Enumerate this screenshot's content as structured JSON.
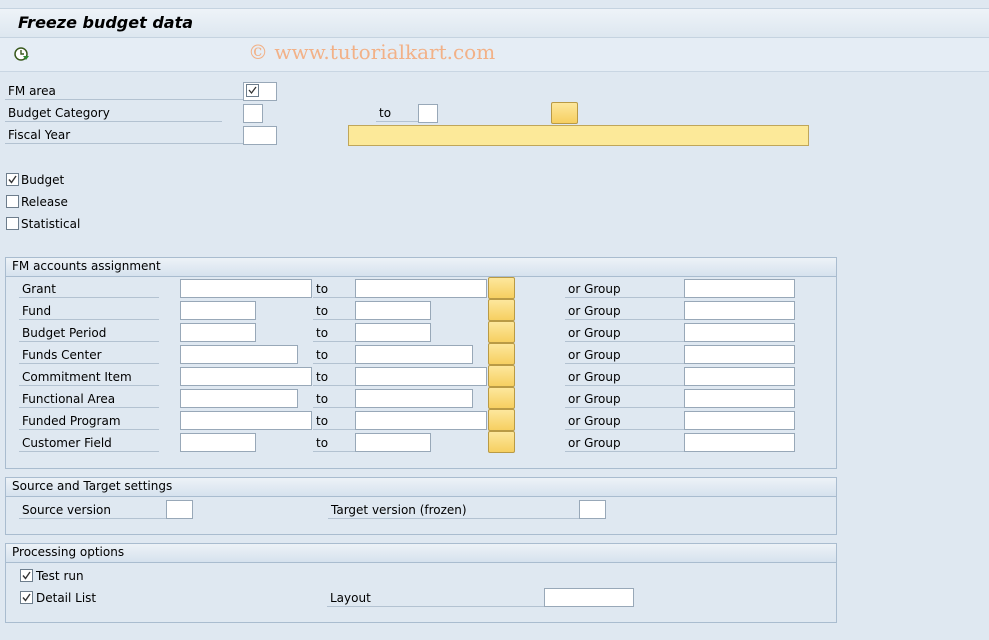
{
  "title": "Freeze budget data",
  "watermark": "© www.tutorialkart.com",
  "toolbar": {
    "execute_icon": "execute-clock-icon"
  },
  "header_fields": {
    "fm_area": {
      "label": "FM area"
    },
    "budget_category": {
      "label": "Budget Category",
      "to_label": "to"
    },
    "fiscal_year": {
      "label": "Fiscal Year"
    }
  },
  "checkboxes": [
    {
      "label": "Budget",
      "checked": true
    },
    {
      "label": "Release",
      "checked": false
    },
    {
      "label": "Statistical",
      "checked": false
    }
  ],
  "fm_accounts": {
    "title": "FM accounts assignment",
    "to_label": "to",
    "or_group_label": "or Group",
    "rows": [
      {
        "label": "Grant"
      },
      {
        "label": "Fund"
      },
      {
        "label": "Budget Period"
      },
      {
        "label": "Funds Center"
      },
      {
        "label": "Commitment Item"
      },
      {
        "label": "Functional Area"
      },
      {
        "label": "Funded Program"
      },
      {
        "label": "Customer Field"
      }
    ]
  },
  "source_target": {
    "title": "Source and Target settings",
    "source_label": "Source version",
    "target_label": "Target version (frozen)"
  },
  "processing": {
    "title": "Processing options",
    "test_run": {
      "label": "Test run",
      "checked": true
    },
    "detail_list": {
      "label": "Detail List",
      "checked": true
    },
    "layout_label": "Layout"
  },
  "colors": {
    "background": "#dfe8f1",
    "multi_select": "#f6cf61",
    "watermark": "#f2b187"
  }
}
